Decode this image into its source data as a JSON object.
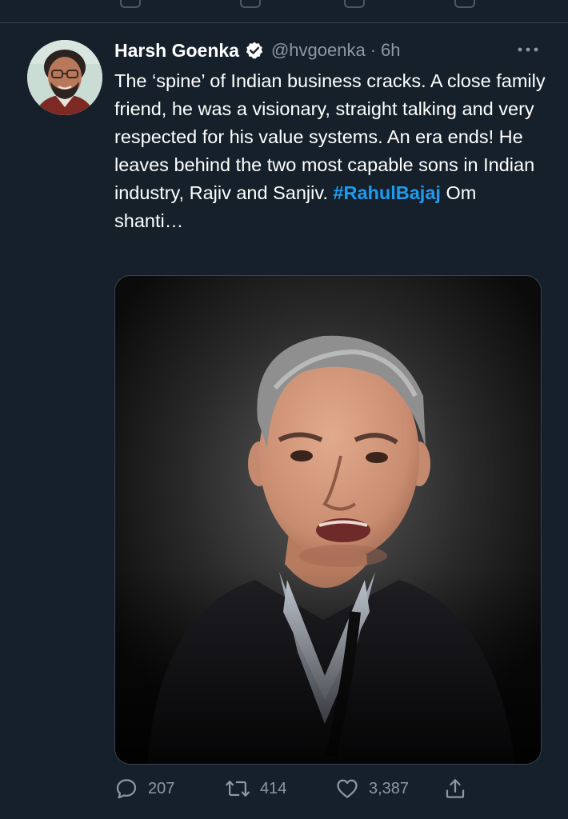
{
  "tweet": {
    "author_name": "Harsh Goenka",
    "handle": "@hvgoenka",
    "separator": "·",
    "time": "6h",
    "text_before": "The ‘spine’ of Indian business cracks. A close family friend, he was a visionary, straight talking and very respected for his value systems. An era ends! He leaves behind the two most capable sons in Indian industry, Rajiv and Sanjiv. ",
    "hashtag": "#RahulBajaj",
    "text_after": " Om shanti…",
    "verified": true
  },
  "actions": {
    "reply_count": "207",
    "retweet_count": "414",
    "like_count": "3,387"
  },
  "icons": {
    "verified": "verified-badge-icon",
    "more": "more-horizontal-icon",
    "reply": "reply-icon",
    "retweet": "retweet-icon",
    "like": "like-heart-icon",
    "share": "share-icon"
  },
  "colors": {
    "background": "#15202b",
    "accent": "#1d9bf0",
    "secondary_text": "#8b98a5",
    "divider": "#38444d"
  }
}
